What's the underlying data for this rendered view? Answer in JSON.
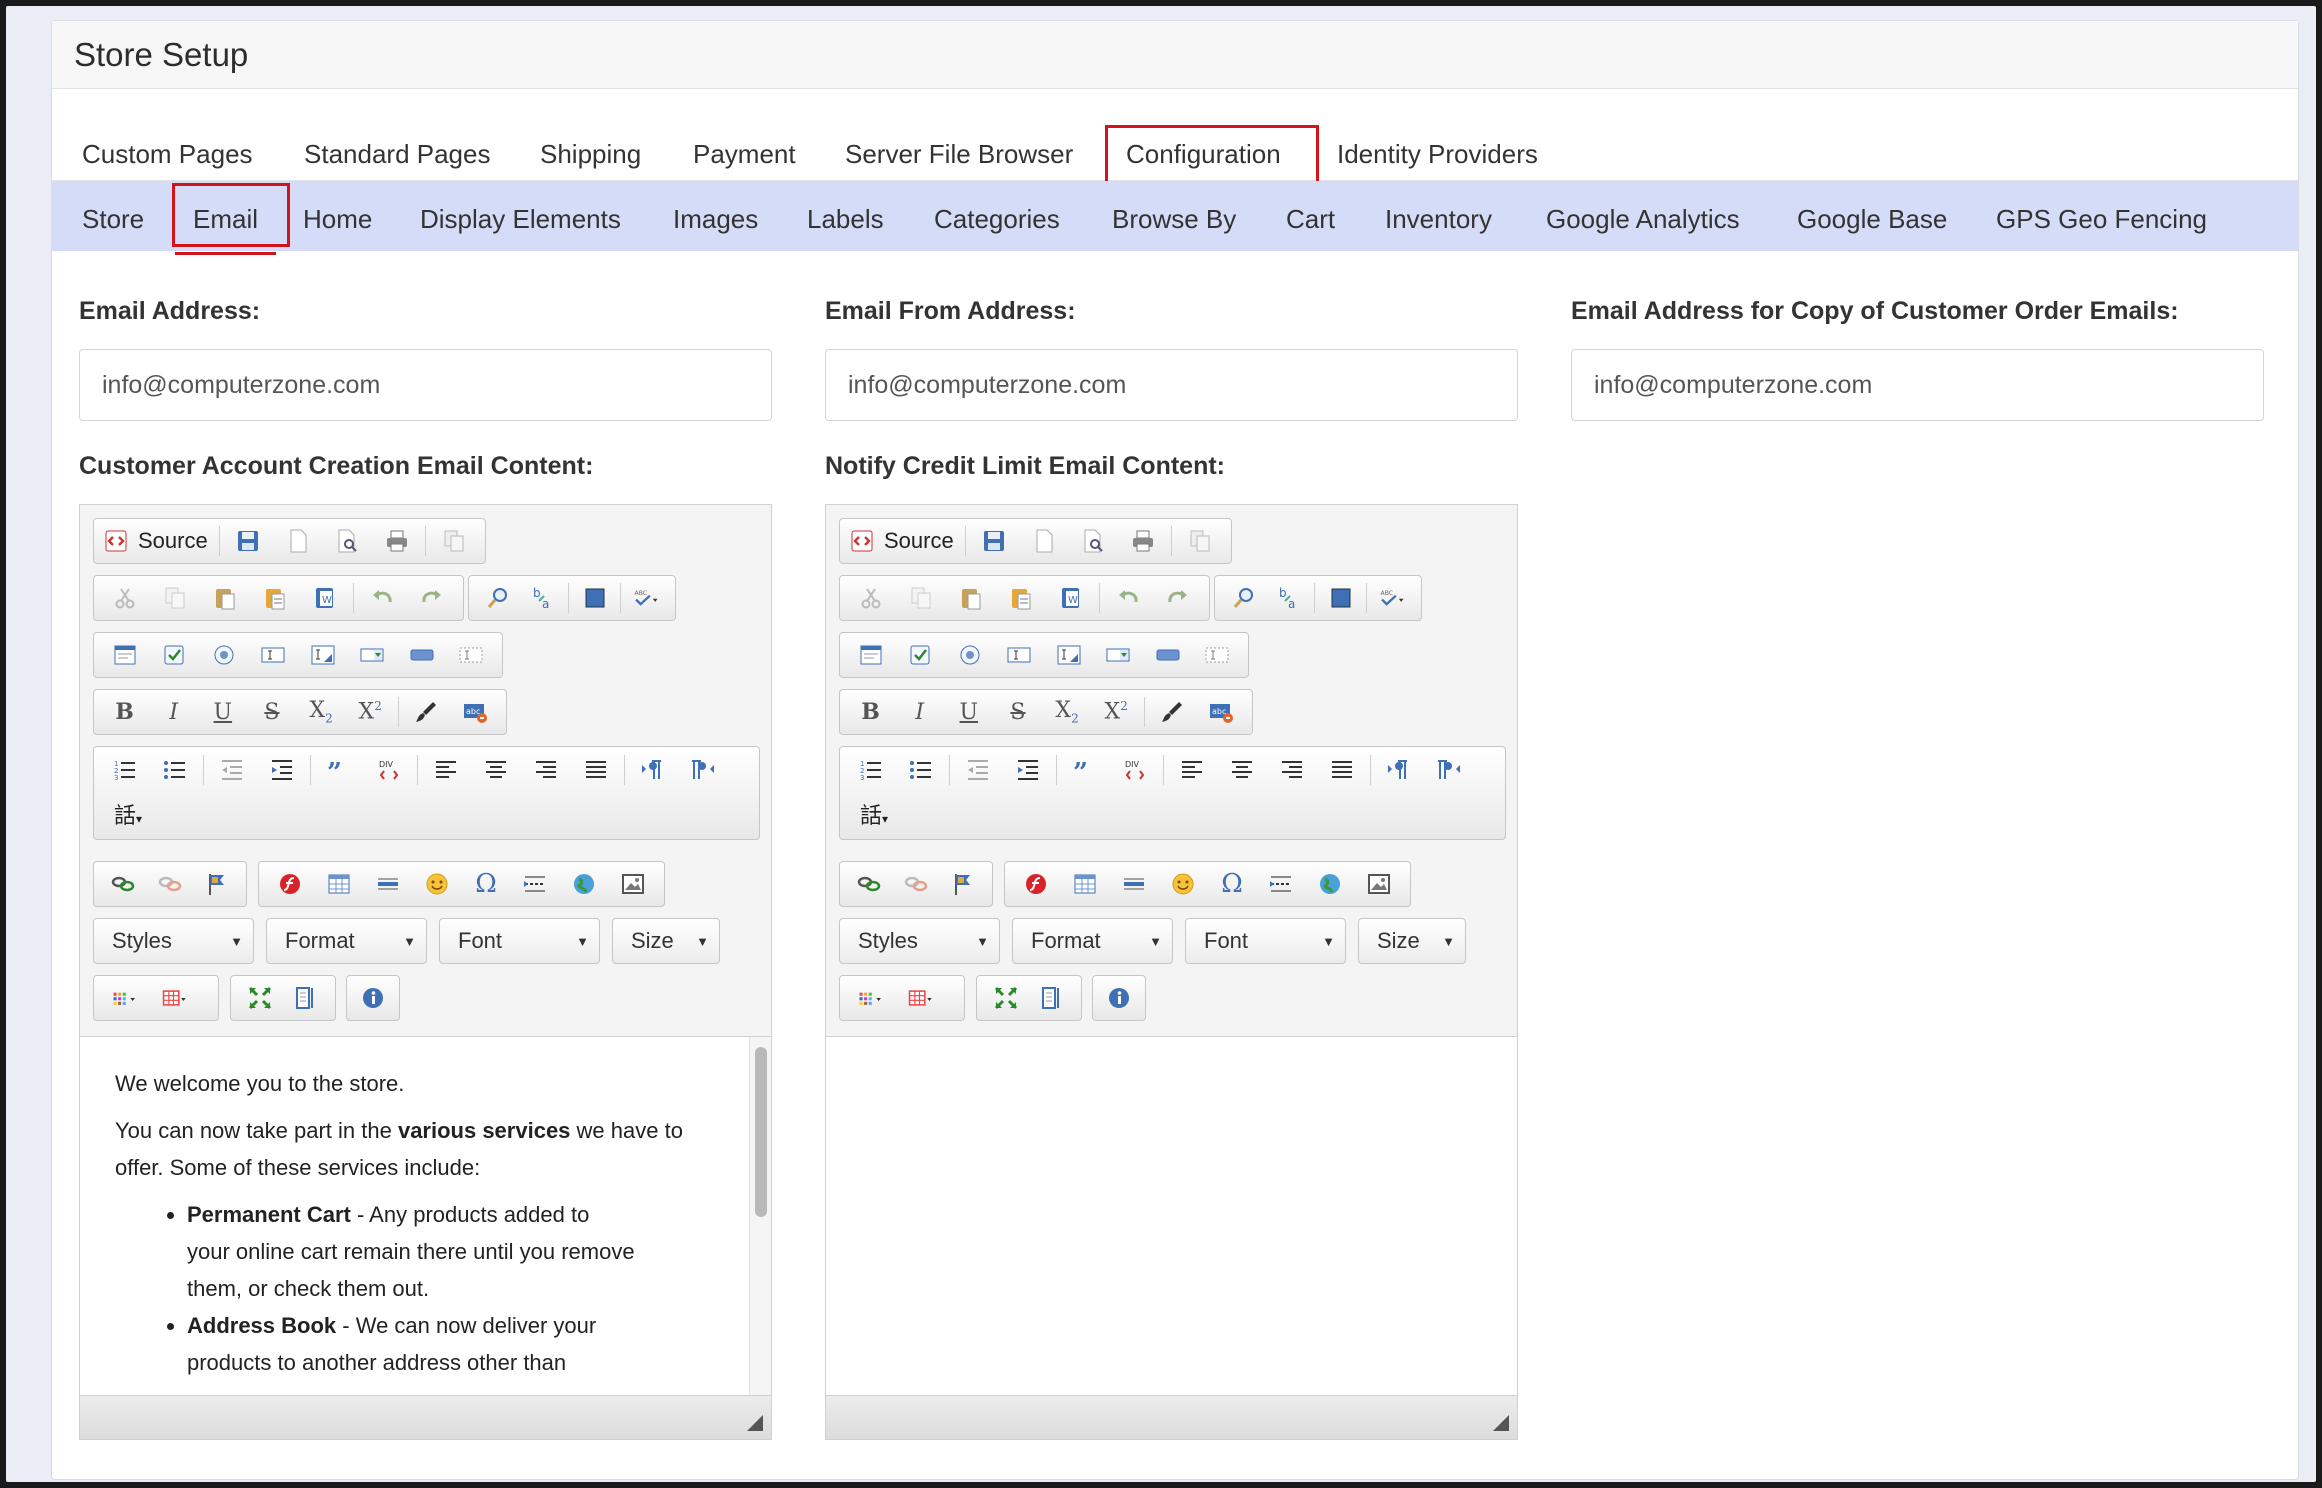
{
  "panel_title": "Store Setup",
  "main_tabs": [
    "Custom Pages",
    "Standard Pages",
    "Shipping",
    "Payment",
    "Server File Browser",
    "Configuration",
    "Identity Providers"
  ],
  "active_main_tab": "Configuration",
  "sub_tabs": [
    "Store",
    "Email",
    "Home",
    "Display Elements",
    "Images",
    "Labels",
    "Categories",
    "Browse By",
    "Cart",
    "Inventory",
    "Google Analytics",
    "Google Base",
    "GPS Geo Fencing"
  ],
  "active_sub_tab": "Email",
  "fields": {
    "email_address": {
      "label": "Email Address:",
      "value": "info@computerzone.com"
    },
    "email_from": {
      "label": "Email From Address:",
      "value": "info@computerzone.com"
    },
    "email_copy": {
      "label": "Email Address for Copy of Customer Order Emails:",
      "value": "info@computerzone.com"
    }
  },
  "editors": {
    "account_creation": {
      "label": "Customer Account Creation Email Content:",
      "source_label": "Source",
      "combos": [
        "Styles",
        "Format",
        "Font",
        "Size"
      ],
      "content": {
        "p1": "We welcome you to the store.",
        "p2_before": "You can now take part in the ",
        "p2_bold": "various services",
        "p2_after": " we have to offer. Some of these services include:",
        "items": [
          {
            "bold": "Permanent Cart",
            "text": " - Any products added to your online cart remain there until you remove them, or check them out."
          },
          {
            "bold": "Address Book",
            "text": " - We can now deliver your products to another address other than"
          }
        ]
      }
    },
    "credit_limit": {
      "label": "Notify Credit Limit Email Content:",
      "source_label": "Source",
      "combos": [
        "Styles",
        "Format",
        "Font",
        "Size"
      ]
    }
  },
  "icons": {
    "source": "source-icon",
    "save": "save-icon",
    "new_page": "new-page-icon",
    "preview": "preview-icon",
    "print": "print-icon",
    "templates": "templates-icon",
    "accent_color": "#d3141b",
    "subtab_bar_color": "#d5dcf7"
  }
}
